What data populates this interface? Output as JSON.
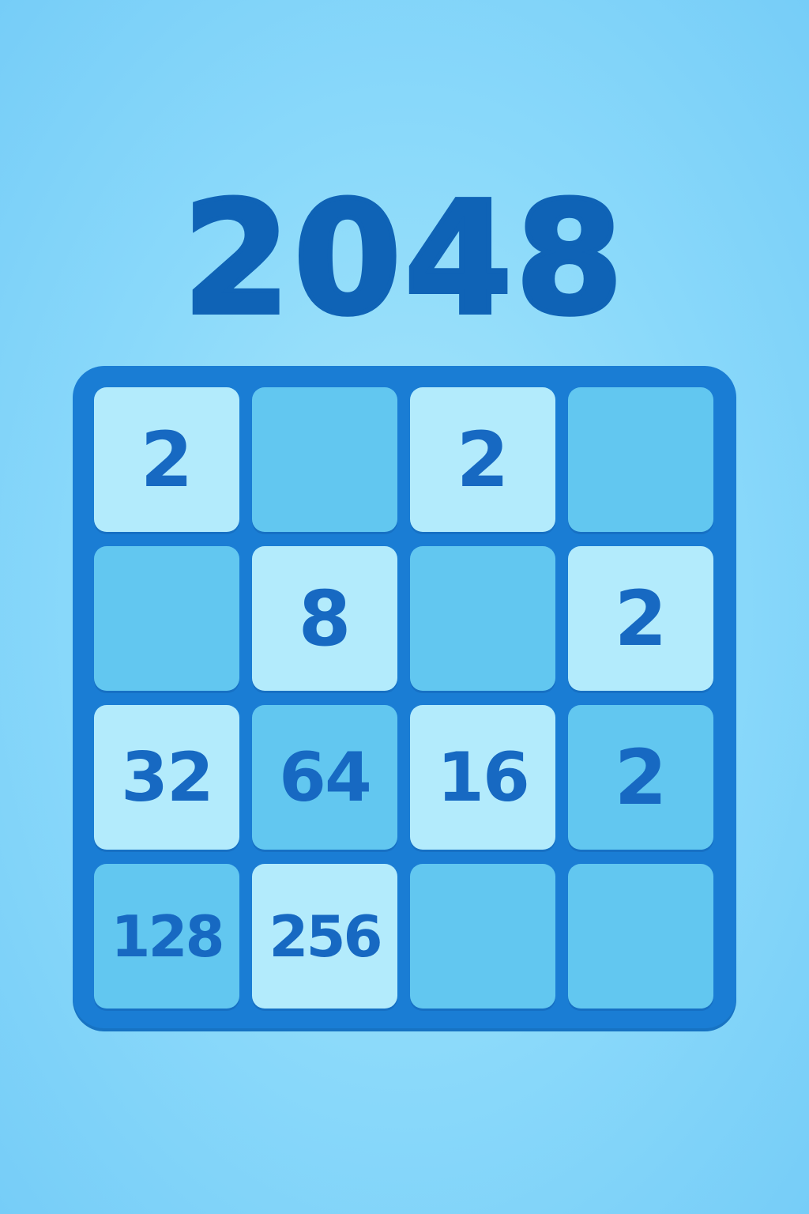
{
  "game": {
    "title": "2048"
  },
  "colors": {
    "background": "#8ad9fa",
    "title": "#0f63b6",
    "board": "#1a7dd4",
    "tile_light": "#b3ebfc",
    "tile_mid": "#62c7f0",
    "number": "#1769c2"
  },
  "board": {
    "rows": [
      [
        {
          "value": "2",
          "style": "light"
        },
        {
          "value": "",
          "style": "empty"
        },
        {
          "value": "2",
          "style": "light"
        },
        {
          "value": "",
          "style": "empty"
        }
      ],
      [
        {
          "value": "",
          "style": "empty"
        },
        {
          "value": "8",
          "style": "light"
        },
        {
          "value": "",
          "style": "empty"
        },
        {
          "value": "2",
          "style": "light"
        }
      ],
      [
        {
          "value": "32",
          "style": "light"
        },
        {
          "value": "64",
          "style": "mid"
        },
        {
          "value": "16",
          "style": "light"
        },
        {
          "value": "2",
          "style": "mid"
        }
      ],
      [
        {
          "value": "128",
          "style": "mid"
        },
        {
          "value": "256",
          "style": "light"
        },
        {
          "value": "",
          "style": "empty"
        },
        {
          "value": "",
          "style": "empty"
        }
      ]
    ]
  }
}
